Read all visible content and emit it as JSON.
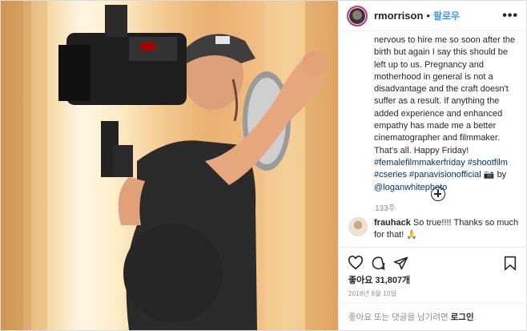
{
  "post": {
    "username": "rmorrison",
    "separator": "•",
    "follow_label": "팔로우",
    "more_label": "•••"
  },
  "caption": {
    "text_before": "nervous to hire me so soon after the birth but again I say this should be left up to us. Pregnancy and motherhood in general is not a disadvantage and the craft doesn't suffer as a result. If anything the added experience and enhanced empathy has made me a better cinematographer and filmmaker. That's all. Happy Friday!",
    "hashtags": [
      "#femalefilmmakerfriday",
      "#shootfilm",
      "#cseries",
      "#panavisionofficial"
    ],
    "camera_emoji": "📷",
    "by": "by",
    "mention": "@loganwhitephoto",
    "age": "133주"
  },
  "load_more": {
    "icon": "plus-circle-icon"
  },
  "comment": {
    "username": "frauhack",
    "text": "So true!!!! Thanks so much for that! 🙏"
  },
  "actions": {
    "icons": [
      "heart-icon",
      "comment-icon",
      "share-icon",
      "bookmark-icon"
    ],
    "likes": "좋아요 31,807개",
    "date": "2018년 8월 10일"
  },
  "login_bar": {
    "text": "좋아요 또는 댓글을 남기려면 ",
    "link": "로그인",
    "suffix": "."
  }
}
